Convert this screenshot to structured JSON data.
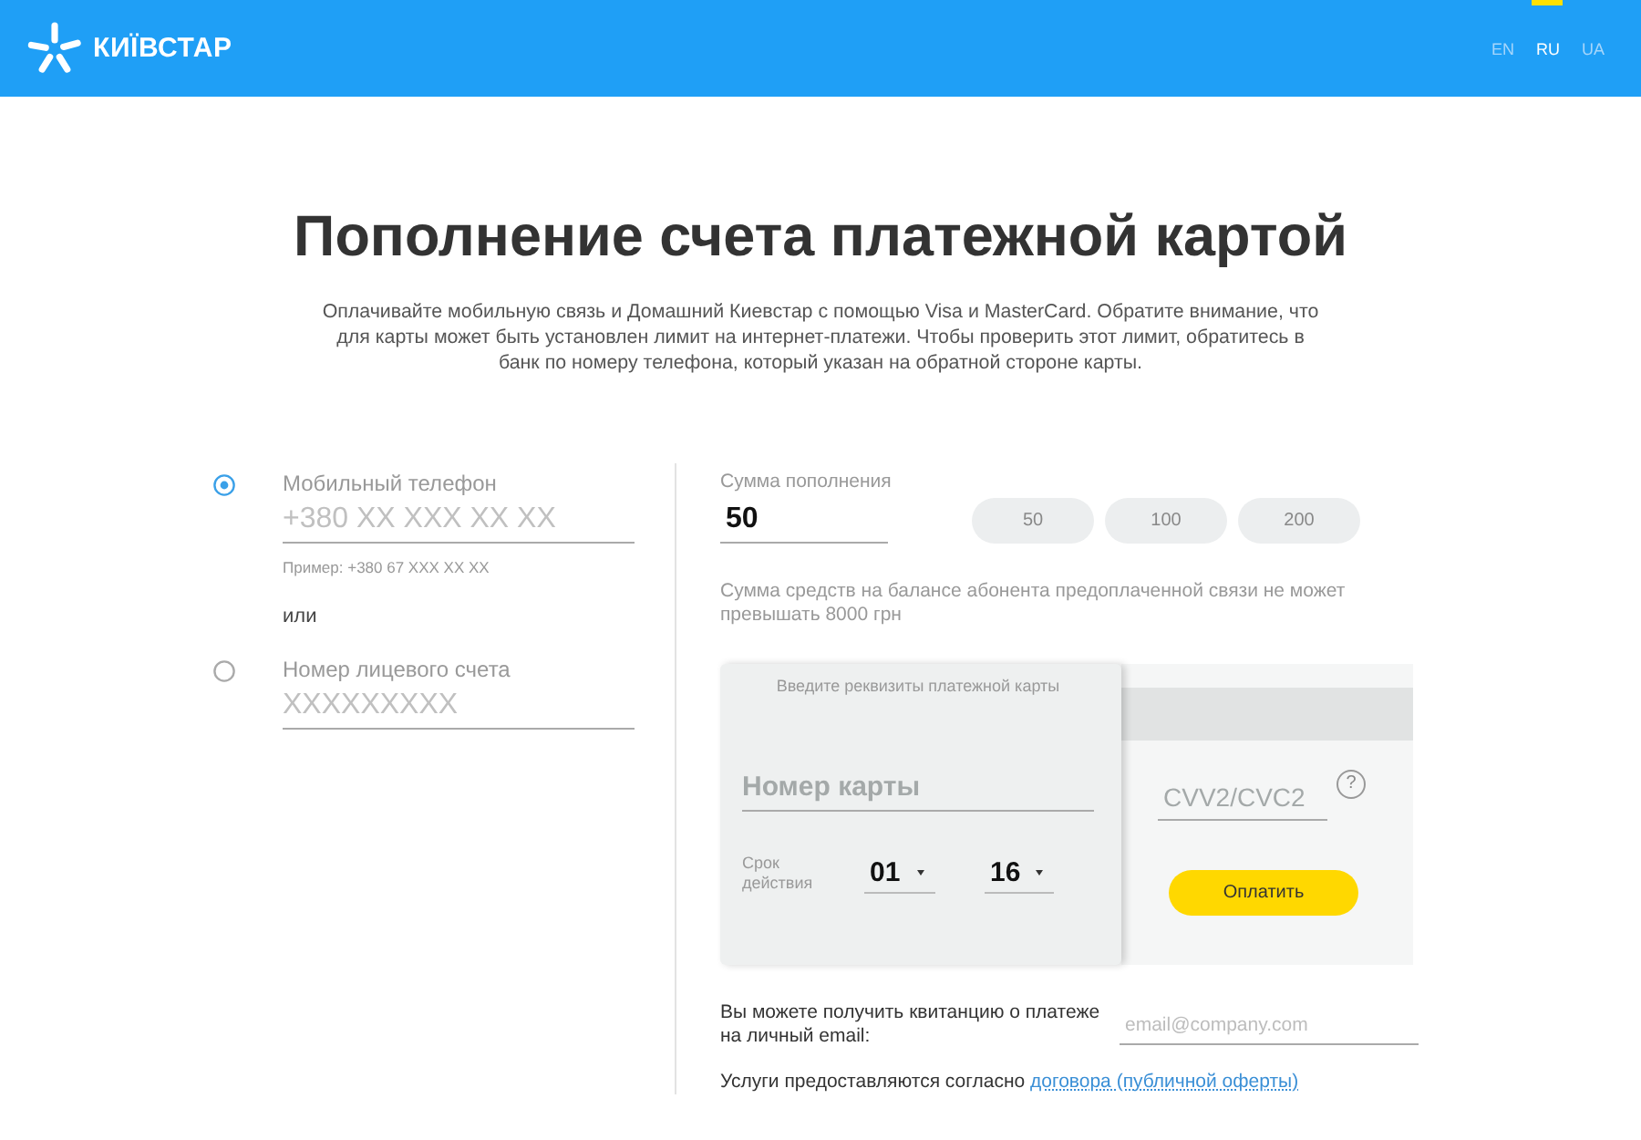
{
  "header": {
    "logo_text": "КИЇВСТАР",
    "languages": [
      {
        "label": "EN",
        "selected": false
      },
      {
        "label": "RU",
        "selected": true
      },
      {
        "label": "UA",
        "selected": false
      }
    ]
  },
  "title": "Пополнение счета платежной картой",
  "description": "Оплачивайте мобильную связь и Домашний Киевстар с помощью Visa и MasterCard. Обратите внимание, что для карты может быть установлен лимит на интернет-платежи. Чтобы проверить этот лимит, обратитесь в банк по номеру телефона, который указан на обратной стороне карты.",
  "identification": {
    "options": [
      {
        "label": "Мобильный телефон",
        "placeholder": "+380 XX XXX XX XX",
        "hint": "Пример: +380 67 XXX XX XX",
        "selected": true
      },
      {
        "label": "Номер лицевого счета",
        "placeholder": "XXXXXXXXX",
        "selected": false
      }
    ],
    "separator": "или"
  },
  "amount": {
    "label": "Сумма пополнения",
    "value": "50",
    "presets": [
      "50",
      "100",
      "200"
    ],
    "note": "Сумма средств на балансе абонента предоплаченной связи не может превышать 8000 грн"
  },
  "card": {
    "heading": "Введите реквизиты платежной карты",
    "number_placeholder": "Номер карты",
    "expiry_label": "Срок действия",
    "month": "01",
    "year": "16",
    "cvv_placeholder": "CVV2/CVC2",
    "cvv_help": "?",
    "pay_button": "Оплатить"
  },
  "receipt": {
    "label": "Вы можете получить квитанцию о платеже на личный email:",
    "placeholder": "email@company.com"
  },
  "terms": {
    "text": "Услуги предоставляются согласно",
    "link": "договора (публичной оферты)"
  }
}
